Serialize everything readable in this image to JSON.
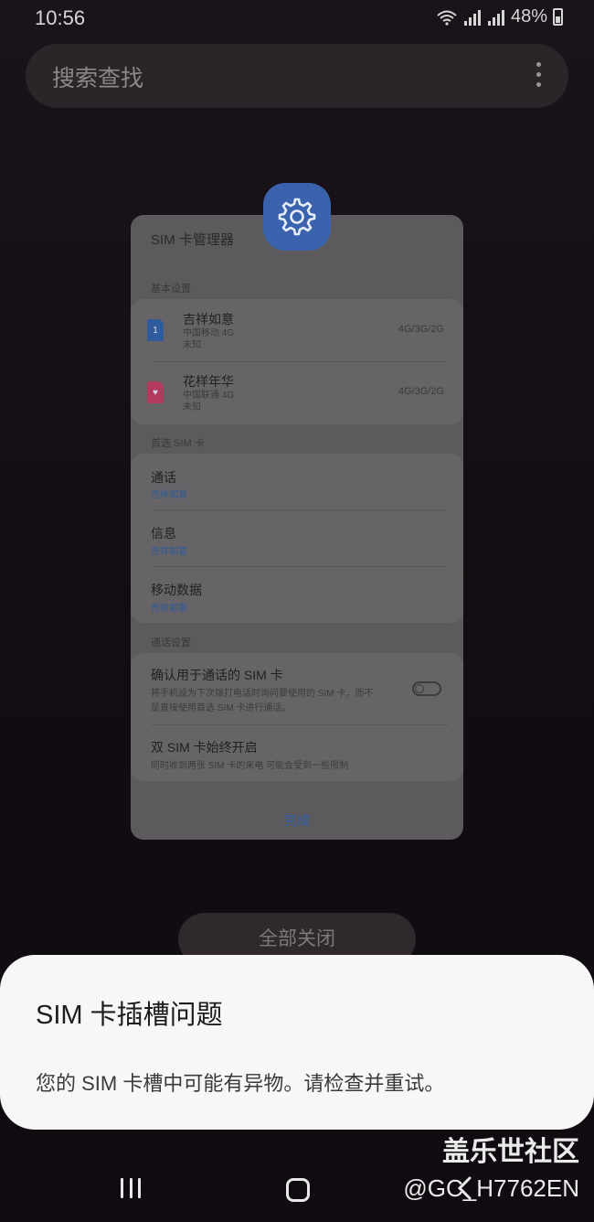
{
  "status_bar": {
    "time": "10:56",
    "battery": "48%"
  },
  "search": {
    "placeholder": "搜索查找"
  },
  "recent_app": {
    "title": "SIM 卡管理器",
    "sections": {
      "basic": "基本设置",
      "preferred": "首选 SIM 卡",
      "call_settings": "通话设置"
    },
    "sims": [
      {
        "name": "吉祥如意",
        "carrier": "中国移动 4G",
        "status": "未知",
        "network": "4G/3G/2G",
        "slot": "1",
        "color": "#2e5b9c"
      },
      {
        "name": "花样年华",
        "carrier": "中国联通 4G",
        "status": "未知",
        "network": "4G/3G/2G",
        "slot": "♥",
        "color": "#b23a5e"
      }
    ],
    "preferred": [
      {
        "title": "通话",
        "value": "吉祥如意"
      },
      {
        "title": "信息",
        "value": "吉祥如意"
      },
      {
        "title": "移动数据",
        "value": "吉祥如意"
      }
    ],
    "call_options": [
      {
        "title": "确认用于通话的 SIM 卡",
        "desc_line1": "将手机设为下次拨打电话时询问要使用的 SIM 卡，而不",
        "desc_line2": "是直接使用首选 SIM 卡进行通话。",
        "toggle": "off"
      },
      {
        "title": "双 SIM 卡始终开启",
        "desc_line1": "同时收到两张 SIM 卡的来电 可能会受到一些限制"
      }
    ],
    "done": "完成"
  },
  "close_all": "全部关闭",
  "alert": {
    "title": "SIM 卡插槽问题",
    "message": "您的 SIM 卡槽中可能有异物。请检查并重试。"
  },
  "watermark": {
    "title": "盖乐世社区",
    "handle": "@GC_H7762EN"
  },
  "colors": {
    "accent": "#2d5ea8",
    "icon_bg": "#3b63ad",
    "alert_bg": "#f7f7f7"
  },
  "icons": [
    "wifi-icon",
    "signal-icon",
    "battery-icon",
    "more-vert-icon",
    "settings-gear-icon",
    "sim-card-icon",
    "recents-icon",
    "home-icon",
    "back-icon"
  ]
}
